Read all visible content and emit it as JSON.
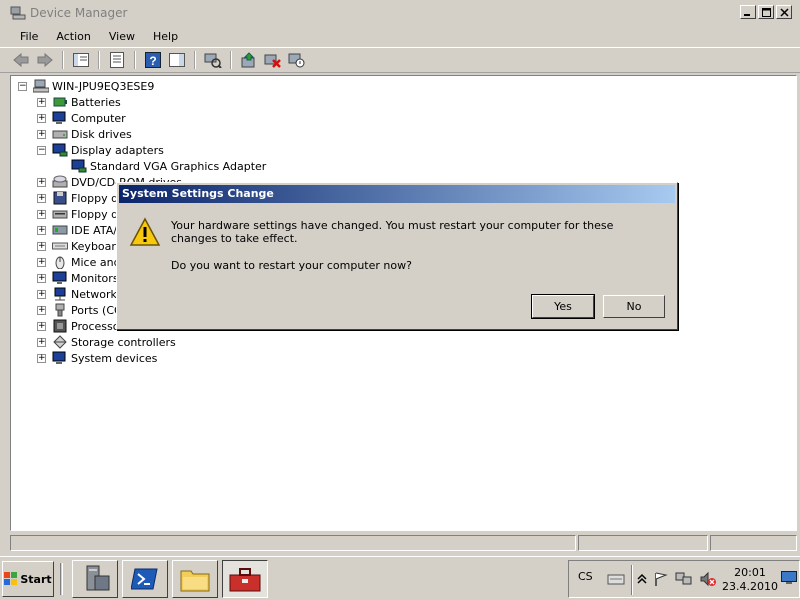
{
  "window": {
    "title": "Device Manager",
    "controls": [
      "minimize",
      "maximize",
      "close"
    ]
  },
  "menubar": [
    "File",
    "Action",
    "View",
    "Help"
  ],
  "toolbar": {
    "icons": [
      "back-icon",
      "forward-icon",
      "up-icon",
      "properties-icon",
      "help-icon",
      "console-tree-icon",
      "scan-hardware-icon",
      "update-driver-icon",
      "uninstall-icon",
      "disable-icon"
    ]
  },
  "tree": {
    "root": "WIN-JPU9EQ3ESE9",
    "items": [
      {
        "label": "Batteries",
        "expanded": false
      },
      {
        "label": "Computer",
        "expanded": false
      },
      {
        "label": "Disk drives",
        "expanded": false
      },
      {
        "label": "Display adapters",
        "expanded": true
      },
      {
        "label": "Standard VGA Graphics Adapter",
        "child": true
      },
      {
        "label": "DVD/CD-ROM drives",
        "expanded": false
      },
      {
        "label": "Floppy di",
        "expanded": false
      },
      {
        "label": "Floppy dr",
        "expanded": false
      },
      {
        "label": "IDE ATA/",
        "expanded": false
      },
      {
        "label": "Keyboard",
        "expanded": false
      },
      {
        "label": "Mice and",
        "expanded": false
      },
      {
        "label": "Monitors",
        "expanded": false
      },
      {
        "label": "Network",
        "expanded": false
      },
      {
        "label": "Ports (CO",
        "expanded": false
      },
      {
        "label": "Processo",
        "expanded": false
      },
      {
        "label": "Storage controllers",
        "expanded": false
      },
      {
        "label": "System devices",
        "expanded": false
      }
    ]
  },
  "dialog": {
    "title": "System Settings Change",
    "message": "Your hardware settings have changed. You must restart your computer for these changes to take effect.",
    "question": "Do you want to restart your computer now?",
    "yes": "Yes",
    "no": "No"
  },
  "taskbar": {
    "start": "Start",
    "apps": [
      "server-manager-icon",
      "powershell-icon",
      "explorer-icon",
      "device-manager-toolbox-icon"
    ],
    "language": "CS",
    "time": "20:01",
    "date": "23.4.2010"
  },
  "colors": {
    "titlebar_active": "#0a246a",
    "titlebar_gradient_end": "#a6caf0",
    "face": "#d4d0c8"
  }
}
